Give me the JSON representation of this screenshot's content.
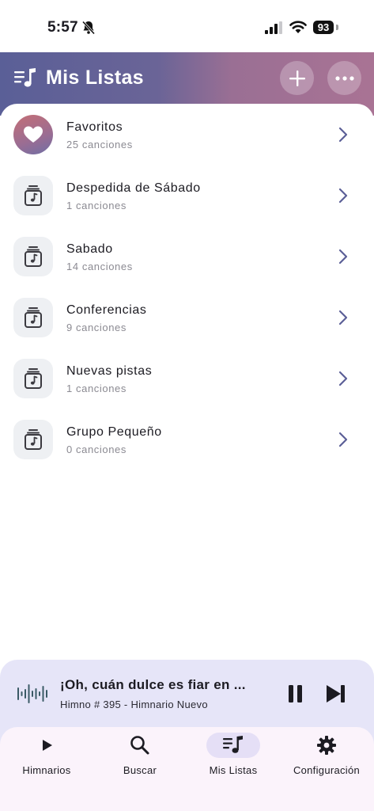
{
  "status": {
    "time": "5:57",
    "battery": "93"
  },
  "header": {
    "title": "Mis Listas"
  },
  "playlists": [
    {
      "title": "Favoritos",
      "subtitle": "25 canciones",
      "icon": "heart-icon"
    },
    {
      "title": "Despedida de Sábado",
      "subtitle": "1 canciones",
      "icon": "music-file-icon"
    },
    {
      "title": "Sabado",
      "subtitle": "14 canciones",
      "icon": "music-file-icon"
    },
    {
      "title": "Conferencias",
      "subtitle": "9 canciones",
      "icon": "music-file-icon"
    },
    {
      "title": "Nuevas pistas",
      "subtitle": "1 canciones",
      "icon": "music-file-icon"
    },
    {
      "title": "Grupo Pequeño",
      "subtitle": "0 canciones",
      "icon": "music-file-icon"
    }
  ],
  "now_playing": {
    "title": "¡Oh, cuán dulce es fiar en ...",
    "subtitle": "Himno # 395 - Himnario Nuevo"
  },
  "nav": {
    "items": [
      {
        "label": "Himnarios",
        "icon": "play-icon"
      },
      {
        "label": "Buscar",
        "icon": "search-icon"
      },
      {
        "label": "Mis Listas",
        "icon": "playlist-icon"
      },
      {
        "label": "Configuración",
        "icon": "gear-icon"
      }
    ],
    "active": "Mis Listas"
  },
  "colors": {
    "header_start": "#5a5f97",
    "header_end": "#a97394",
    "accent": "#5b5f97",
    "player_bg": "#e6e5f8",
    "nav_bg": "#fbf3fb"
  }
}
